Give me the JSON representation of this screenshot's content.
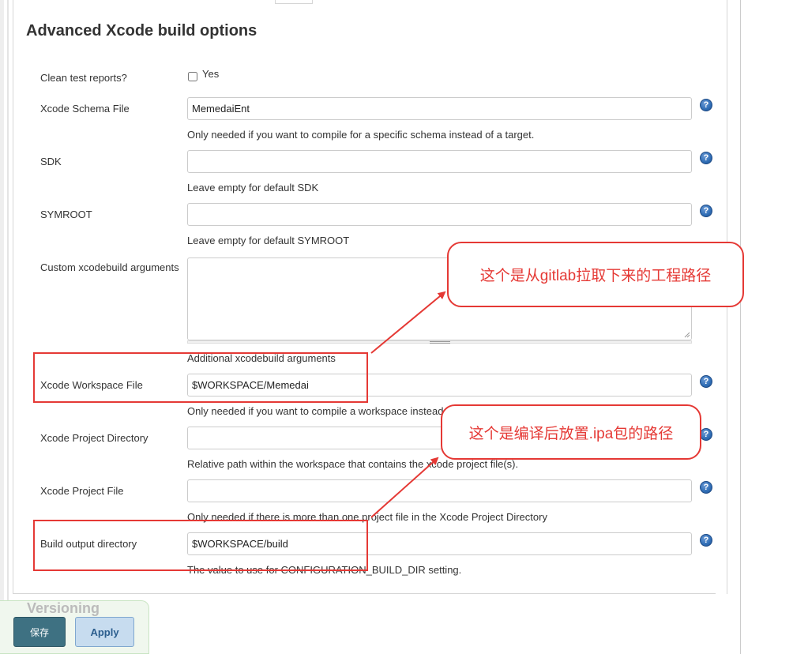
{
  "section": {
    "title": "Advanced Xcode build options"
  },
  "fields": {
    "clean_test_reports": {
      "label": "Clean test reports?",
      "checkbox_label": "Yes"
    },
    "schema_file": {
      "label": "Xcode Schema File",
      "value": "MemedaiEnt",
      "hint": "Only needed if you want to compile for a specific schema instead of a target."
    },
    "sdk": {
      "label": "SDK",
      "value": "",
      "hint": "Leave empty for default SDK"
    },
    "symroot": {
      "label": "SYMROOT",
      "value": "",
      "hint": "Leave empty for default SYMROOT"
    },
    "custom_args": {
      "label": "Custom xcodebuild arguments",
      "value": "",
      "hint": "Additional xcodebuild arguments"
    },
    "workspace_file": {
      "label": "Xcode Workspace File",
      "value": "$WORKSPACE/Memedai",
      "hint": "Only needed if you want to compile a workspace instead of a project."
    },
    "project_directory": {
      "label": "Xcode Project Directory",
      "value": "",
      "hint": "Relative path within the workspace that contains the xcode project file(s)."
    },
    "project_file": {
      "label": "Xcode Project File",
      "value": "",
      "hint": "Only needed if there is more than one project file in the Xcode Project Directory"
    },
    "build_output_directory": {
      "label": "Build output directory",
      "value": "$WORKSPACE/build",
      "hint": "The value to use for CONFIGURATION_BUILD_DIR setting."
    }
  },
  "help_icon_glyph": "?",
  "annotations": {
    "workspace_note": "这个是从gitlab拉取下来的工程路径",
    "output_note": "这个是编译后放置.ipa包的路径",
    "color": "#e53935"
  },
  "footer": {
    "section_peek": "Versioning",
    "save_label": "保存",
    "apply_label": "Apply"
  },
  "colors": {
    "save_button": "#3e7182",
    "apply_button": "#c7dcef",
    "help_icon": "#2f6db5"
  }
}
